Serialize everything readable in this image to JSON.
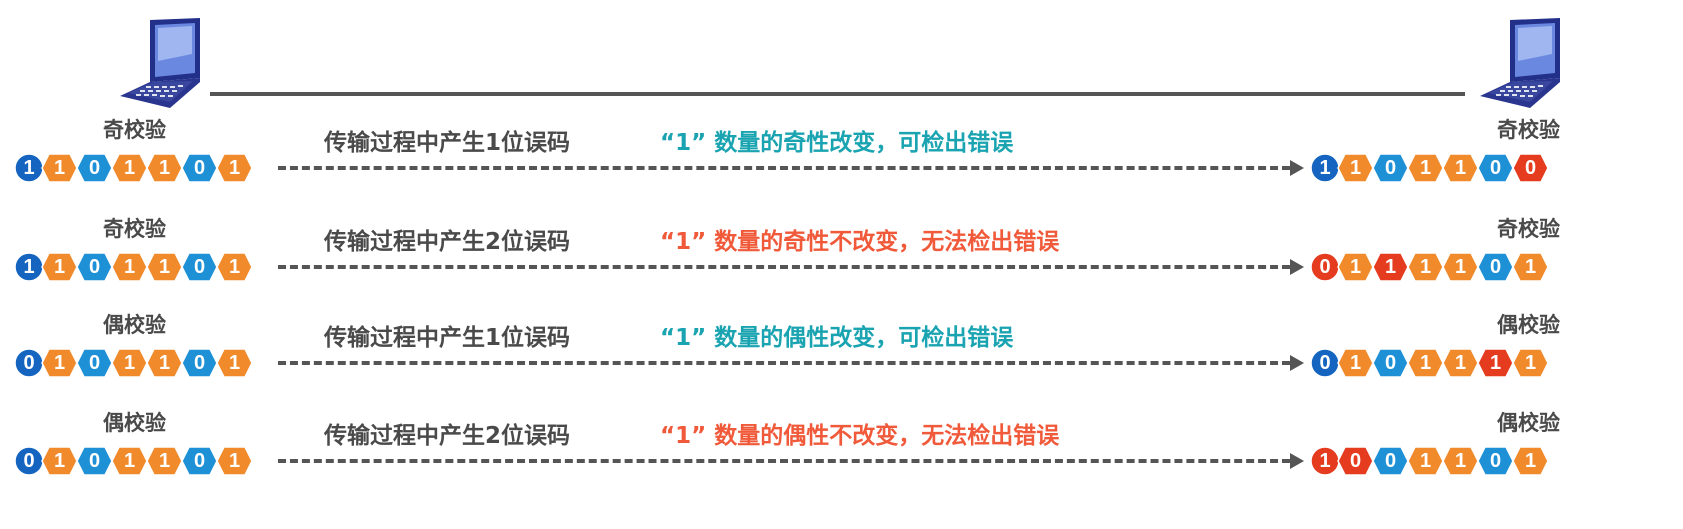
{
  "colors": {
    "parity_bit": "#1565c0",
    "orange": "#f08a2a",
    "blue": "#1e90d6",
    "error": "#e53b1f",
    "ok_text": "#1aa3b0",
    "fail_text": "#f05a3a"
  },
  "rows": [
    {
      "left_label": "奇校验",
      "right_label": "奇校验",
      "caption": "传输过程中产生1位误码",
      "result": "“1” 数量的奇性改变，可检出错误",
      "result_kind": "ok",
      "sent": [
        "1",
        "1",
        "0",
        "1",
        "1",
        "0",
        "1"
      ],
      "received": [
        "1",
        "1",
        "0",
        "1",
        "1",
        "0",
        "0"
      ],
      "received_errors": [
        6
      ]
    },
    {
      "left_label": "奇校验",
      "right_label": "奇校验",
      "caption": "传输过程中产生2位误码",
      "result": "“1” 数量的奇性不改变，无法检出错误",
      "result_kind": "fail",
      "sent": [
        "1",
        "1",
        "0",
        "1",
        "1",
        "0",
        "1"
      ],
      "received": [
        "0",
        "1",
        "1",
        "1",
        "1",
        "0",
        "1"
      ],
      "received_errors": [
        0,
        2
      ]
    },
    {
      "left_label": "偶校验",
      "right_label": "偶校验",
      "caption": "传输过程中产生1位误码",
      "result": "“1” 数量的偶性改变，可检出错误",
      "result_kind": "ok",
      "sent": [
        "0",
        "1",
        "0",
        "1",
        "1",
        "0",
        "1"
      ],
      "received": [
        "0",
        "1",
        "0",
        "1",
        "1",
        "1",
        "1"
      ],
      "received_errors": [
        5
      ]
    },
    {
      "left_label": "偶校验",
      "right_label": "偶校验",
      "caption": "传输过程中产生2位误码",
      "result": "“1” 数量的偶性不改变，无法检出错误",
      "result_kind": "fail",
      "sent": [
        "0",
        "1",
        "0",
        "1",
        "1",
        "0",
        "1"
      ],
      "received": [
        "1",
        "0",
        "0",
        "1",
        "1",
        "0",
        "1"
      ],
      "received_errors": [
        0,
        1
      ]
    }
  ]
}
